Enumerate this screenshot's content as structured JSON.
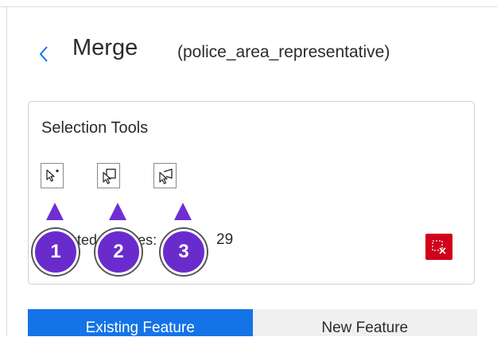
{
  "header": {
    "back_icon": "chevron-left-icon",
    "title": "Merge",
    "subtitle": "(police_area_representative)"
  },
  "selection_tools": {
    "title": "Selection Tools",
    "tools": [
      {
        "icon": "select-point-icon"
      },
      {
        "icon": "select-rectangle-icon"
      },
      {
        "icon": "select-lasso-icon"
      }
    ],
    "selected_label": "Selected features:",
    "selected_count": "29",
    "clear_icon": "clear-selection-icon"
  },
  "callouts": [
    "1",
    "2",
    "3"
  ],
  "tabs": [
    {
      "label": "Existing Feature",
      "active": true
    },
    {
      "label": "New Feature",
      "active": false
    }
  ],
  "colors": {
    "accent": "#1473e6",
    "callout": "#6a2bcd",
    "danger": "#d0021b"
  }
}
